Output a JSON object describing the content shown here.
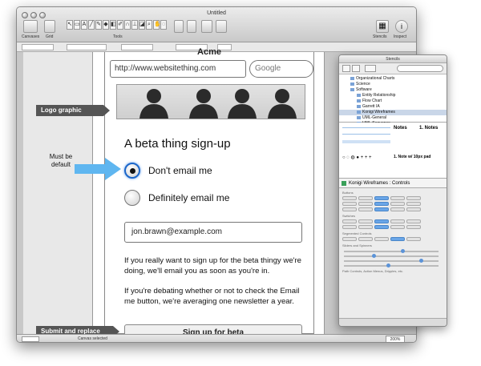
{
  "window": {
    "title": "Untitled",
    "toolbar": {
      "canvases_label": "Canvases",
      "grid_label": "Grid",
      "tools_label": "Tools",
      "stencils_label": "Stencils",
      "inspect_label": "Inspect"
    },
    "status": {
      "text": "Canvas selected",
      "zoom": "200%"
    }
  },
  "mockup": {
    "acme_text": "Acme",
    "url_value": "http://www.websitething.com",
    "search_placeholder": "Google",
    "heading": "A beta thing sign-up",
    "radio_options": [
      {
        "label": "Don't email me",
        "selected": true
      },
      {
        "label": "Definitely email me",
        "selected": false
      }
    ],
    "email_value": "jon.brawn@example.com",
    "paragraph1": "If you really want to sign up for the beta thingy we're doing, we'll email you as soon as you're in.",
    "paragraph2": "If you're debating whether or not to check the Email me button, we're averaging one newsletter a year.",
    "submit_label": "Sign up for beta"
  },
  "annotations": {
    "logo_callout": "Logo graphic",
    "default_note": "Must be default",
    "submit_callout": "Submit and replace"
  },
  "stencils_panel": {
    "title": "Stencils",
    "tree": [
      {
        "label": "Organizational Charts",
        "sub": false,
        "selected": false
      },
      {
        "label": "Science",
        "sub": false,
        "selected": false
      },
      {
        "label": "Software",
        "sub": false,
        "selected": false
      },
      {
        "label": "Entity Relationship",
        "sub": true,
        "selected": false
      },
      {
        "label": "Flow Chart",
        "sub": true,
        "selected": false
      },
      {
        "label": "Garrett IA",
        "sub": true,
        "selected": false
      },
      {
        "label": "Konigi Wireframes",
        "sub": true,
        "selected": true
      },
      {
        "label": "UML-General",
        "sub": true,
        "selected": false
      },
      {
        "label": "UML-Sequence",
        "sub": true,
        "selected": false
      }
    ],
    "notes_heading_1": "Notes",
    "notes_heading_2": "1. Notes",
    "notes_pad": "1. Note w/ 10px pad",
    "palette_title": "Konigi Wireframes : Controls",
    "sections": [
      "Buttons",
      "Switches",
      "Segmented Controls",
      "Sliders and Spinners",
      "Path Controls, Action Menus, Dripples, etc."
    ]
  },
  "colors": {
    "accent": "#1b66c9",
    "callout_bg": "#555555",
    "arrow": "#5fb6f0"
  }
}
